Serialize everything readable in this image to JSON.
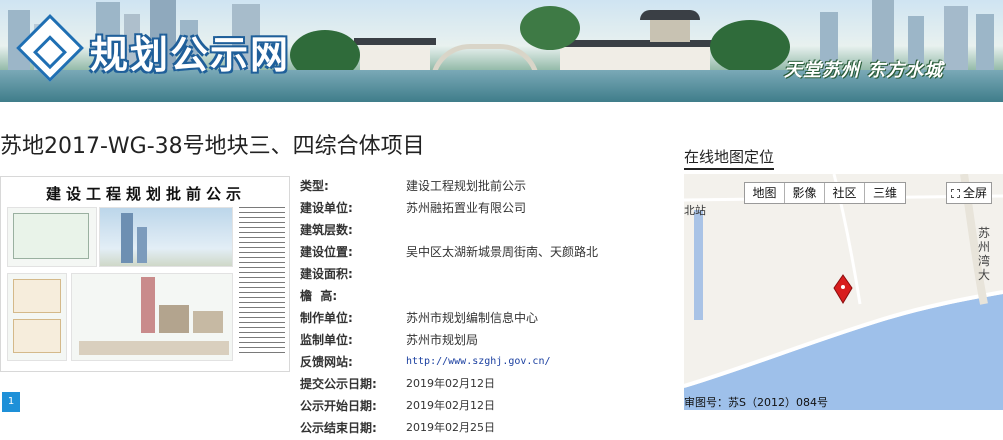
{
  "banner": {
    "logo_text": "规划公示网",
    "slogan": "天堂苏州 东方水城"
  },
  "project": {
    "title": "苏地2017-WG-38号地块三、四综合体项目",
    "board_title": "建设工程规划批前公示",
    "page_number": "1"
  },
  "info": [
    {
      "label": "类型:",
      "value": "建设工程规划批前公示"
    },
    {
      "label": "建设单位:",
      "value": "苏州融拓置业有限公司"
    },
    {
      "label": "建筑层数:",
      "value": ""
    },
    {
      "label": "建设位置:",
      "value": "吴中区太湖新城景周街南、天颜路北"
    },
    {
      "label": "建设面积:",
      "value": ""
    },
    {
      "label": "檐  高:",
      "value": ""
    },
    {
      "label": "制作单位:",
      "value": "苏州市规划编制信息中心"
    },
    {
      "label": "监制单位:",
      "value": "苏州市规划局"
    },
    {
      "label": "反馈网站:",
      "value": "http://www.szghj.gov.cn/"
    },
    {
      "label": "提交公示日期:",
      "value": "2019年02月12日"
    },
    {
      "label": "公示开始日期:",
      "value": "2019年02月12日"
    },
    {
      "label": "公示结束日期:",
      "value": "2019年02月25日"
    }
  ],
  "map": {
    "heading": "在线地图定位",
    "buttons": [
      "地图",
      "影像",
      "社区",
      "三维"
    ],
    "fullscreen": "全屏",
    "place_label": "北站",
    "road_label": "苏州湾大",
    "copyright": "审图号：苏S（2012）084号",
    "marker_color": "#d81e1e",
    "water_color": "#9ec0ea"
  }
}
